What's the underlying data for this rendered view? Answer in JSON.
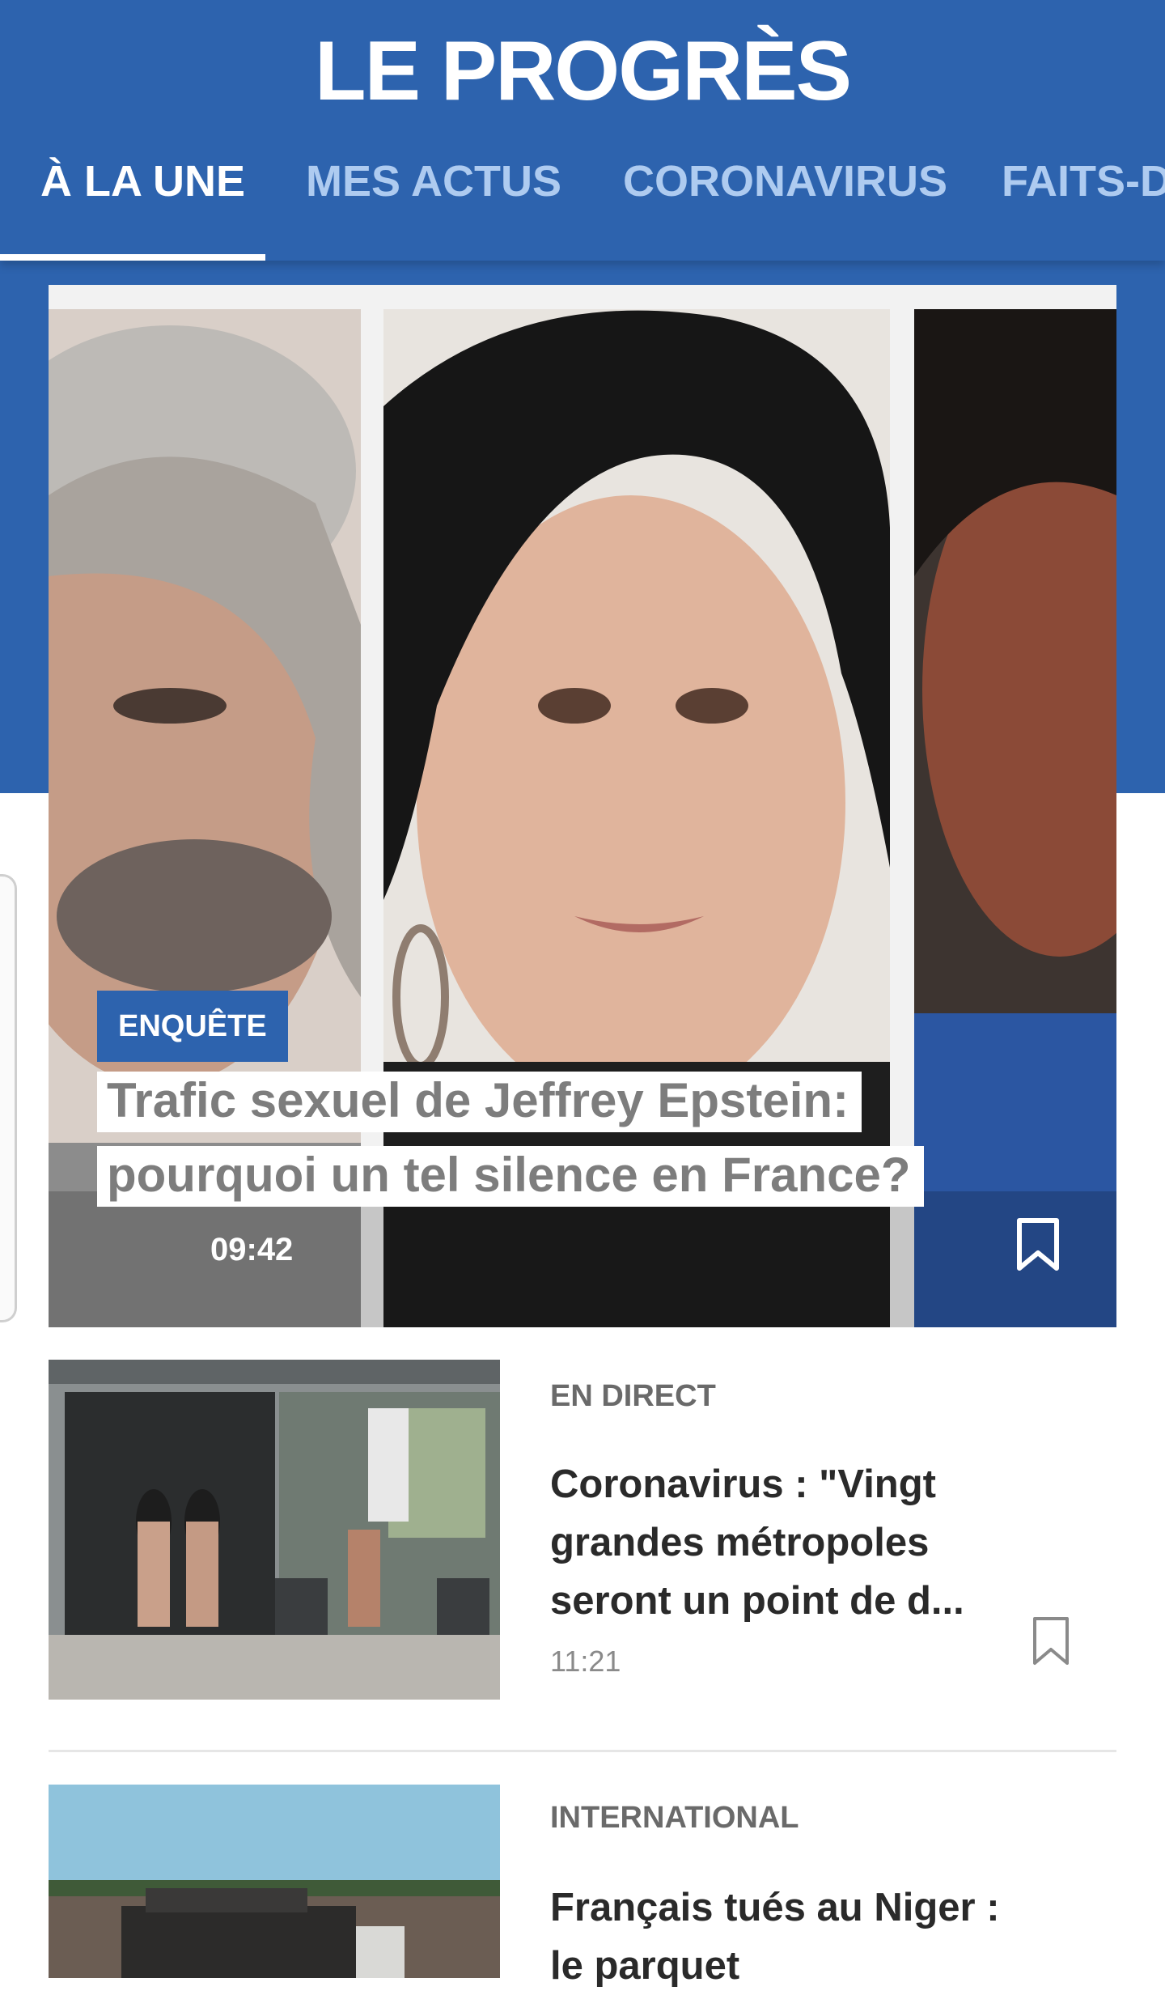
{
  "colors": {
    "brand": "#2d63ae",
    "tab_inactive": "#aecbf0"
  },
  "header": {
    "logo": "LE PROGRÈS",
    "tabs": [
      {
        "label": "À LA UNE",
        "active": true
      },
      {
        "label": "MES ACTUS",
        "active": false
      },
      {
        "label": "CORONAVIRUS",
        "active": false
      },
      {
        "label": "FAITS-D",
        "active": false
      }
    ]
  },
  "hero": {
    "kicker": "ENQUÊTE",
    "title": "Trafic sexuel de Jeffrey Epstein: pourquoi un tel silence en France?",
    "time": "09:42",
    "bookmark_icon": "bookmark-outline"
  },
  "articles": [
    {
      "section": "EN DIRECT",
      "headline": "Coronavirus : \"Vingt grandes métropoles seront un point de d...",
      "time": "11:21",
      "bookmark_icon": "bookmark-outline"
    },
    {
      "section": "INTERNATIONAL",
      "headline": "Français tués au Niger : le parquet",
      "time": "",
      "bookmark_icon": "bookmark-outline"
    }
  ]
}
